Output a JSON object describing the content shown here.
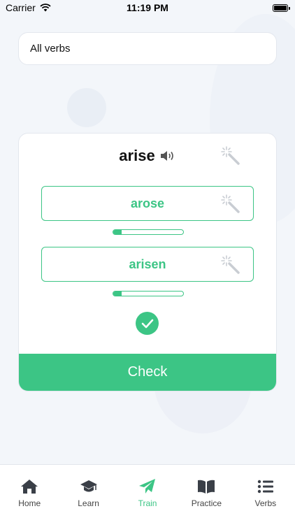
{
  "status_bar": {
    "carrier": "Carrier",
    "time": "11:19 PM"
  },
  "filter": {
    "label": "All verbs"
  },
  "card": {
    "verb": "arise",
    "answers": [
      {
        "value": "arose",
        "progress": 0.12
      },
      {
        "value": "arisen",
        "progress": 0.12
      }
    ],
    "check_label": "Check"
  },
  "tabs": [
    {
      "label": "Home",
      "icon": "home-icon",
      "active": false
    },
    {
      "label": "Learn",
      "icon": "graduation-cap-icon",
      "active": false
    },
    {
      "label": "Train",
      "icon": "paper-plane-icon",
      "active": true
    },
    {
      "label": "Practice",
      "icon": "book-icon",
      "active": false
    },
    {
      "label": "Verbs",
      "icon": "list-icon",
      "active": false
    }
  ],
  "colors": {
    "accent": "#3cc585",
    "inactive_icon": "#3a3f47",
    "hint_icon": "#c9cdd3"
  }
}
